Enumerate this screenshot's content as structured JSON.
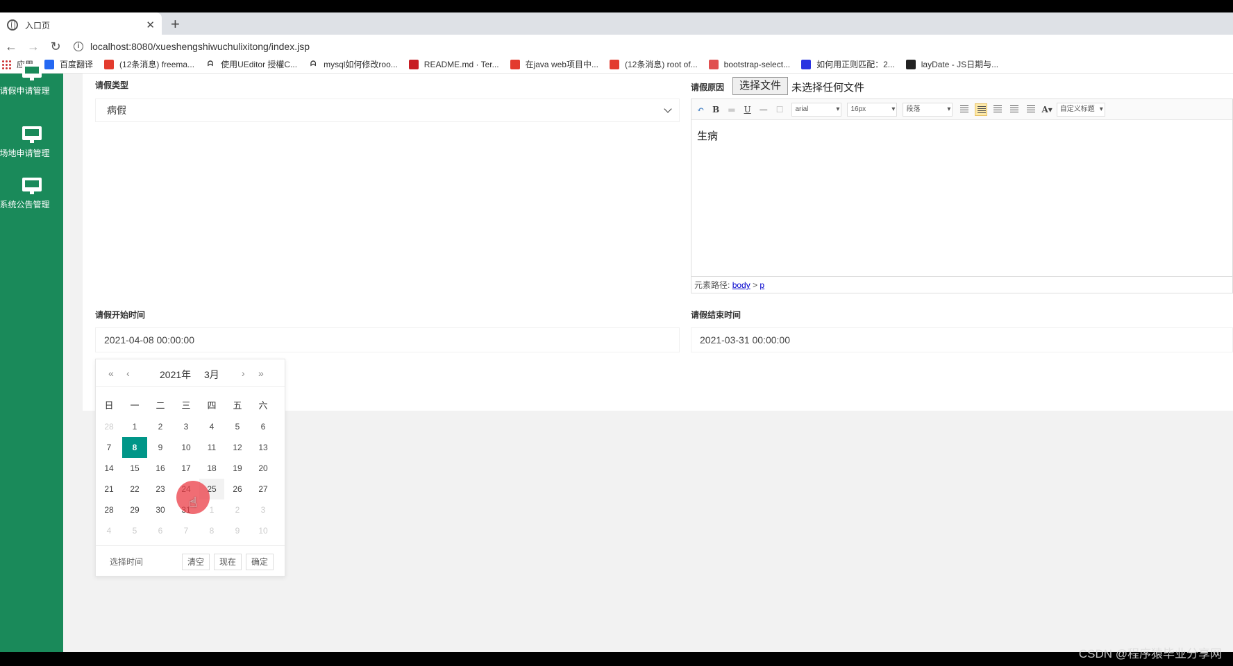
{
  "browser": {
    "tab_title": "入口页",
    "tab_close": "✕",
    "new_tab": "+",
    "url": "localhost:8080/xueshengshiwuchulixitong/index.jsp",
    "bookmarks": [
      {
        "label": "应用",
        "icon": "apps-icon",
        "color": ""
      },
      {
        "label": "百度翻译",
        "icon": "baidu-translate-icon",
        "color": "#2468f2"
      },
      {
        "label": "(12条消息) freema...",
        "icon": "csdn-icon",
        "color": "#e33b2e"
      },
      {
        "label": "使用UEditor 授權C...",
        "icon": "ueditor-icon",
        "color": ""
      },
      {
        "label": "mysql如何修改roo...",
        "icon": "ueditor-icon",
        "color": ""
      },
      {
        "label": "README.md · Ter...",
        "icon": "gitee-icon",
        "color": "#c71d23"
      },
      {
        "label": "在java web项目中...",
        "icon": "csdn-icon",
        "color": "#e33b2e"
      },
      {
        "label": "(12条消息) root of...",
        "icon": "csdn-icon",
        "color": "#e33b2e"
      },
      {
        "label": "bootstrap-select...",
        "icon": "bootstrap-icon",
        "color": "#e05050"
      },
      {
        "label": "如何用正则匹配：2...",
        "icon": "baidu-paw-icon",
        "color": "#2932e1"
      },
      {
        "label": "layDate - JS日期与...",
        "icon": "laydate-icon",
        "color": "#222"
      }
    ]
  },
  "sidebar": {
    "items": [
      {
        "label": "请假申请管理"
      },
      {
        "label": "场地申请管理"
      },
      {
        "label": "系统公告管理"
      }
    ]
  },
  "form": {
    "leave_type_label": "请假类型",
    "leave_type_value": "病假",
    "reason_label": "请假原因",
    "file_button": "选择文件",
    "file_none": "未选择任何文件",
    "editor": {
      "font_family": "arial",
      "font_size": "16px",
      "paragraph": "段落",
      "custom_title": "自定义标题",
      "content": "生病",
      "path_label": "元素路径:",
      "path_body": "body",
      "path_sep": ">",
      "path_p": "p"
    },
    "start_label": "请假开始时间",
    "start_value": "2021-04-08 00:00:00",
    "end_label": "请假结束时间",
    "end_value": "2021-03-31 00:00:00"
  },
  "calendar": {
    "year": "2021年",
    "month": "3月",
    "weekdays": [
      "日",
      "一",
      "二",
      "三",
      "四",
      "五",
      "六"
    ],
    "weeks": [
      [
        "28",
        "1",
        "2",
        "3",
        "4",
        "5",
        "6"
      ],
      [
        "7",
        "8",
        "9",
        "10",
        "11",
        "12",
        "13"
      ],
      [
        "14",
        "15",
        "16",
        "17",
        "18",
        "19",
        "20"
      ],
      [
        "21",
        "22",
        "23",
        "24",
        "25",
        "26",
        "27"
      ],
      [
        "28",
        "29",
        "30",
        "31",
        "1",
        "2",
        "3"
      ],
      [
        "4",
        "5",
        "6",
        "7",
        "8",
        "9",
        "10"
      ]
    ],
    "selected": "8",
    "pick_time": "选择时间",
    "clear": "清空",
    "now": "现在",
    "confirm": "确定"
  },
  "watermark": "CSDN @程序猿毕业分享网",
  "colors": {
    "sidebar": "#1a8a5a",
    "selected_day": "#009688"
  }
}
